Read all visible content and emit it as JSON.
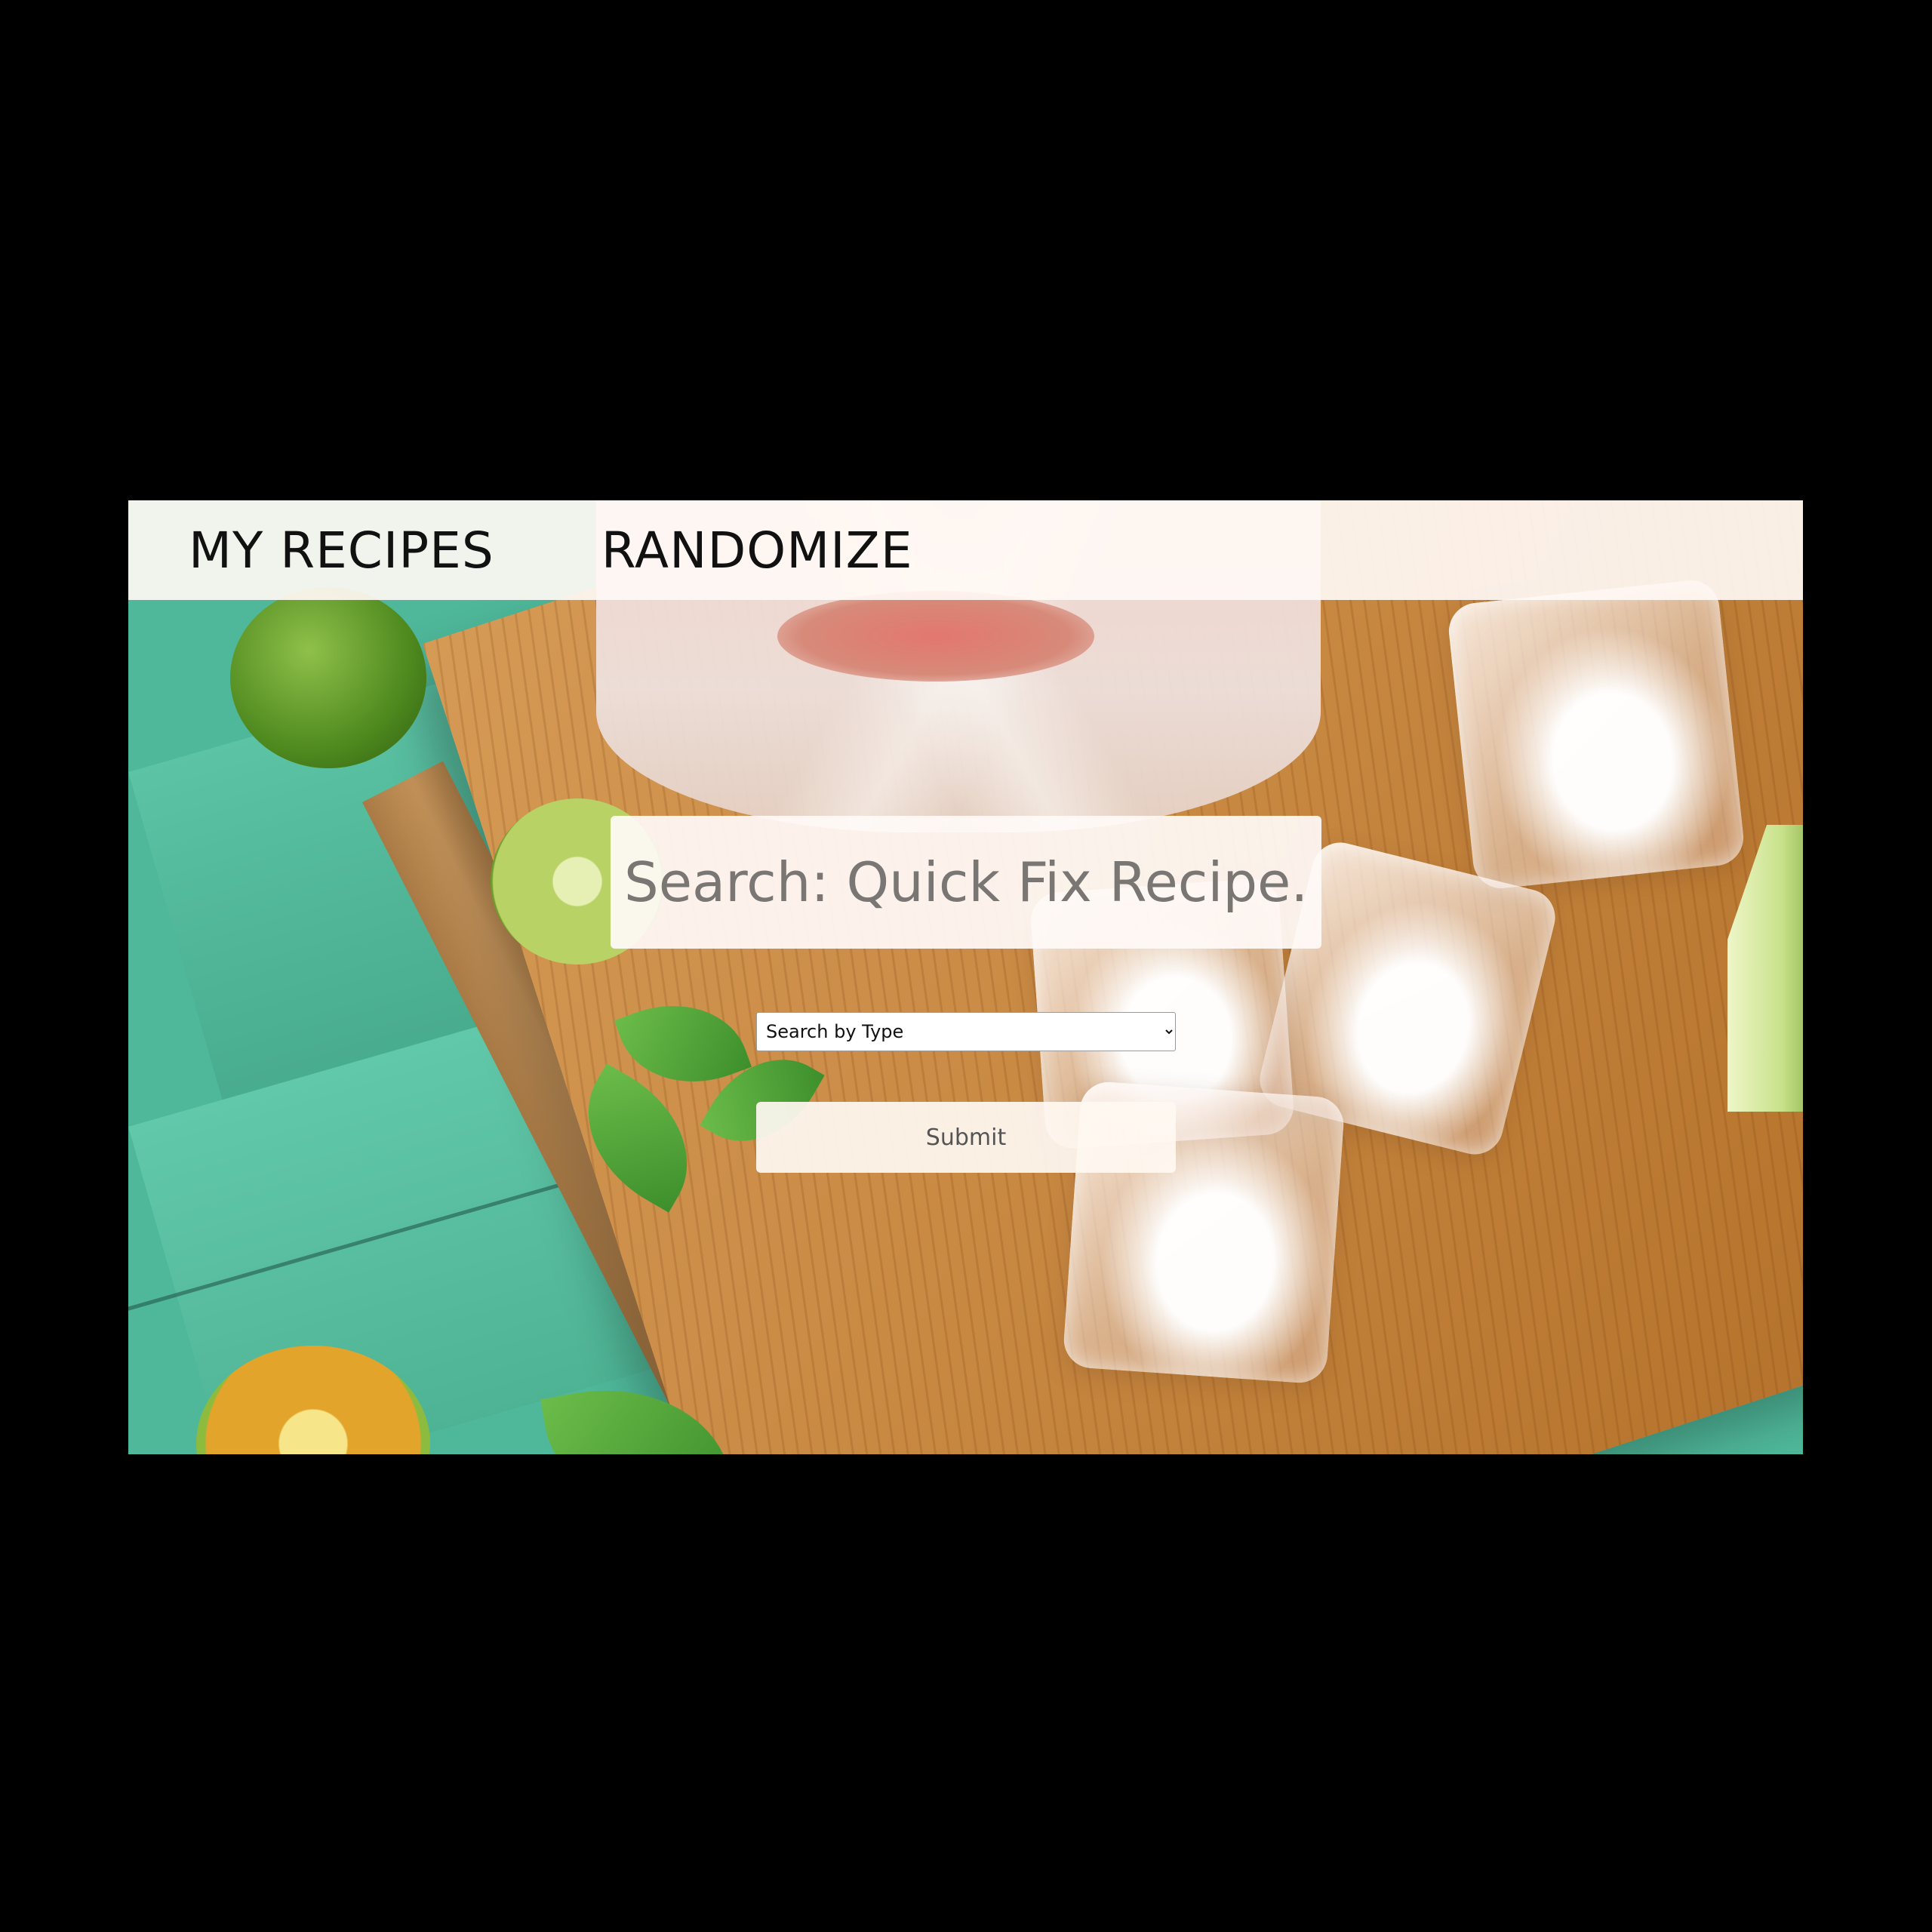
{
  "nav": {
    "links": [
      {
        "label": "MY RECIPES"
      },
      {
        "label": "RANDOMIZE"
      }
    ]
  },
  "search": {
    "placeholder": "Search: Quick Fix Recipe...",
    "value": ""
  },
  "type_select": {
    "selected": "Search by Type"
  },
  "submit": {
    "label": "Submit"
  },
  "colors": {
    "page_background": "#000000",
    "nav_background": "#fff8f4",
    "table_green": "#4fb89a",
    "board_wood": "#c98a44"
  }
}
